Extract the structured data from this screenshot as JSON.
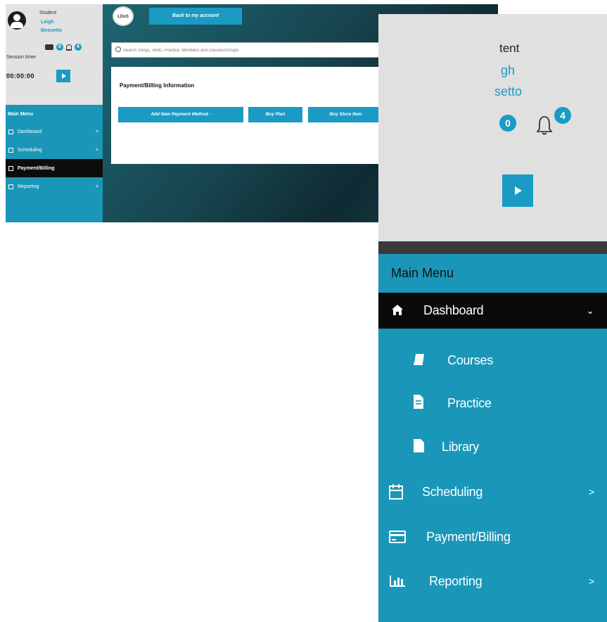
{
  "shot1": {
    "profile": {
      "role": "Student",
      "name_line1": "Leigh",
      "name_line2": "Bossetto",
      "chat_count": "0",
      "notification_count": "4",
      "session_label": "Session timer",
      "timer": "00:00:00"
    },
    "menu": {
      "title": "Main Menu",
      "items": [
        {
          "label": "Dashboard",
          "chevron": ">"
        },
        {
          "label": "Scheduling",
          "chevron": ">"
        },
        {
          "label": "Payment/Billing",
          "chevron": ""
        },
        {
          "label": "Reporting",
          "chevron": ">"
        }
      ],
      "active_item": "Payment/Billing"
    },
    "header": {
      "logo_text": "LDoS",
      "back_button": "Back to my account"
    },
    "search": {
      "placeholder": "Search Songs, Skills, Practice, Members and Classes/Groups"
    },
    "panel": {
      "title": "Payment/Billing Information",
      "buttons": [
        "Add New Payment Method -",
        "Buy Plan",
        "Buy Store Item"
      ]
    },
    "colors": {
      "accent": "#1a9bc4",
      "menu_bg": "#1a96b8",
      "active_bg": "#0c0c0c"
    }
  },
  "shot2": {
    "profile": {
      "role": "tent",
      "name_line1": "gh",
      "name_line2": "setto",
      "chat_count": "0",
      "notification_count": "4"
    },
    "menu": {
      "title": "Main Menu",
      "items": [
        {
          "label": "Dashboard",
          "icon": "home-icon",
          "chevron": "⌄",
          "active": true
        },
        {
          "label": "Courses",
          "icon": "book-icon",
          "chevron": "",
          "sub": true
        },
        {
          "label": "Practice",
          "icon": "document-icon",
          "chevron": "",
          "sub": true
        },
        {
          "label": "Library",
          "icon": "file-icon",
          "chevron": "",
          "sub": true
        },
        {
          "label": "Scheduling",
          "icon": "calendar-icon",
          "chevron": ">"
        },
        {
          "label": "Payment/Billing",
          "icon": "credit-card-icon",
          "chevron": ""
        },
        {
          "label": "Reporting",
          "icon": "bar-chart-icon",
          "chevron": ">"
        }
      ]
    }
  }
}
